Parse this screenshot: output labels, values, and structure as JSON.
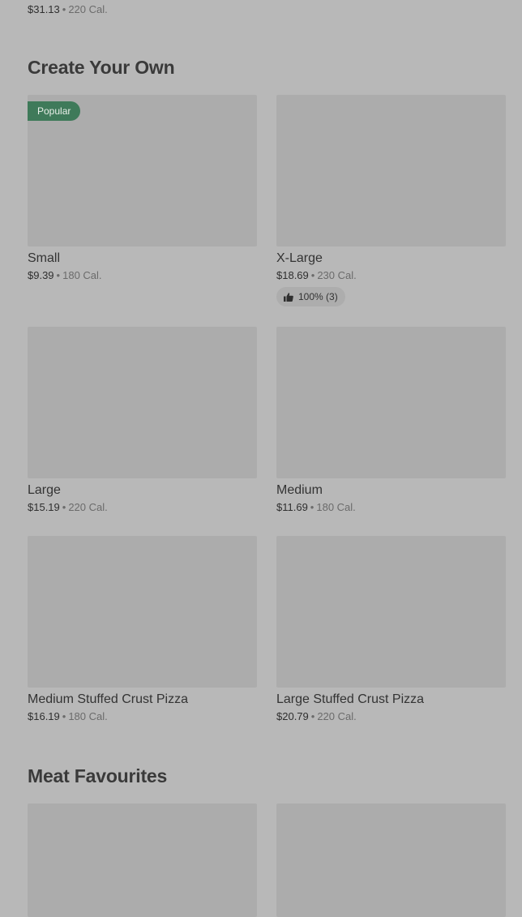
{
  "top_item": {
    "price": "$31.13",
    "calories": "220 Cal."
  },
  "sections": [
    {
      "title": "Create Your Own",
      "items": [
        {
          "name": "Small",
          "price": "$9.39",
          "calories": "180 Cal.",
          "badge": "Popular"
        },
        {
          "name": "X-Large",
          "price": "$18.69",
          "calories": "230 Cal.",
          "rating": "100% (3)"
        },
        {
          "name": "Large",
          "price": "$15.19",
          "calories": "220 Cal."
        },
        {
          "name": "Medium",
          "price": "$11.69",
          "calories": "180 Cal."
        },
        {
          "name": "Medium Stuffed Crust Pizza",
          "price": "$16.19",
          "calories": "180 Cal."
        },
        {
          "name": "Large Stuffed Crust Pizza",
          "price": "$20.79",
          "calories": "220 Cal."
        }
      ]
    },
    {
      "title": "Meat Favourites",
      "items": []
    }
  ],
  "separator": "•",
  "icons": {
    "rating": "thumbs-up-icon"
  }
}
